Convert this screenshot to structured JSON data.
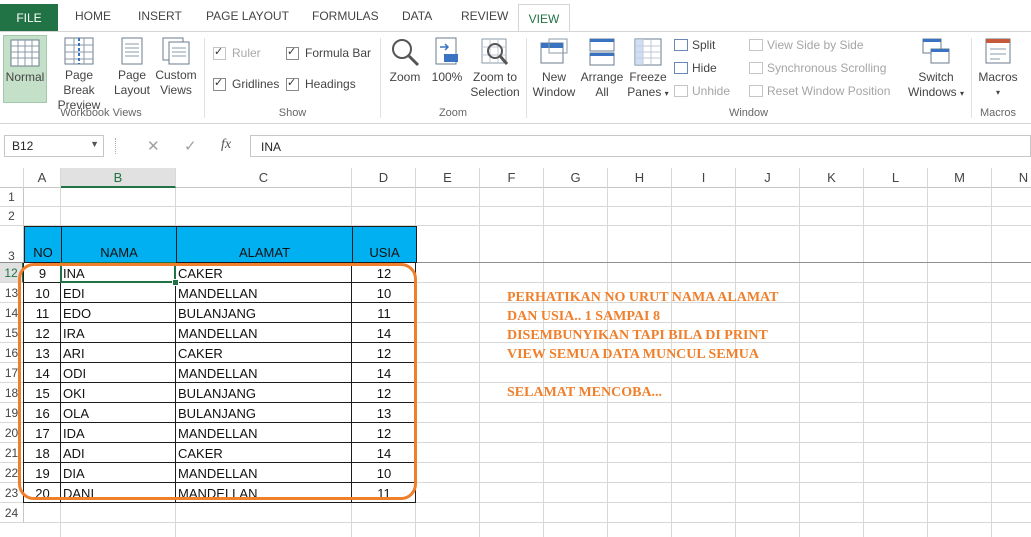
{
  "ribbon_tabs": [
    "FILE",
    "HOME",
    "INSERT",
    "PAGE LAYOUT",
    "FORMULAS",
    "DATA",
    "REVIEW",
    "VIEW"
  ],
  "workbook_views": {
    "normal": "Normal",
    "page_break_1": "Page Break",
    "page_break_2": "Preview",
    "page_layout_1": "Page",
    "page_layout_2": "Layout",
    "custom_1": "Custom",
    "custom_2": "Views",
    "group": "Workbook Views"
  },
  "show": {
    "ruler": "Ruler",
    "gridlines": "Gridlines",
    "formula_bar": "Formula Bar",
    "headings": "Headings",
    "group": "Show"
  },
  "zoom": {
    "zoom": "Zoom",
    "hundred": "100%",
    "zoom_sel_1": "Zoom to",
    "zoom_sel_2": "Selection",
    "group": "Zoom"
  },
  "window": {
    "new_1": "New",
    "new_2": "Window",
    "arrange_1": "Arrange",
    "arrange_2": "All",
    "freeze_1": "Freeze",
    "freeze_2": "Panes",
    "split": "Split",
    "hide": "Hide",
    "unhide": "Unhide",
    "side_by_side": "View Side by Side",
    "sync_scroll": "Synchronous Scrolling",
    "reset_pos": "Reset Window Position",
    "switch_1": "Switch",
    "switch_2": "Windows",
    "group": "Window"
  },
  "macros": {
    "label": "Macros",
    "group": "Macros"
  },
  "formula_bar": {
    "name_box": "B12",
    "fx": "fx",
    "content": "INA"
  },
  "columns": [
    "A",
    "B",
    "C",
    "D",
    "E",
    "F",
    "G",
    "H",
    "I",
    "J",
    "K",
    "L",
    "M",
    "N"
  ],
  "rows": [
    "1",
    "2",
    "3",
    "12",
    "13",
    "14",
    "15",
    "16",
    "17",
    "18",
    "19",
    "20",
    "21",
    "22",
    "23",
    "24"
  ],
  "table": {
    "headers": [
      "NO",
      "NAMA",
      "ALAMAT",
      "USIA"
    ],
    "data": [
      [
        "9",
        "INA",
        "CAKER",
        "12"
      ],
      [
        "10",
        "EDI",
        "MANDELLAN",
        "10"
      ],
      [
        "11",
        "EDO",
        "BULANJANG",
        "11"
      ],
      [
        "12",
        "IRA",
        "MANDELLAN",
        "14"
      ],
      [
        "13",
        "ARI",
        "CAKER",
        "12"
      ],
      [
        "14",
        "ODI",
        "MANDELLAN",
        "14"
      ],
      [
        "15",
        "OKI",
        "BULANJANG",
        "12"
      ],
      [
        "16",
        "OLA",
        "BULANJANG",
        "13"
      ],
      [
        "17",
        "IDA",
        "MANDELLAN",
        "12"
      ],
      [
        "18",
        "ADI",
        "CAKER",
        "14"
      ],
      [
        "19",
        "DIA",
        "MANDELLAN",
        "10"
      ],
      [
        "20",
        "DANI",
        "MANDELLAN",
        "11"
      ]
    ]
  },
  "note": {
    "line1": "PERHATIKAN NO URUT NAMA ALAMAT",
    "line2": "DAN USIA.. 1 SAMPAI 8",
    "line3": "DISEMBUNYIKAN TAPI BILA DI PRINT",
    "line4": "VIEW SEMUA DATA MUNCUL SEMUA",
    "line5": "SELAMAT MENCOBA..."
  },
  "colors": {
    "accent": "#217346",
    "header_fill": "#00b0f0",
    "annotation": "#f07f2b"
  }
}
